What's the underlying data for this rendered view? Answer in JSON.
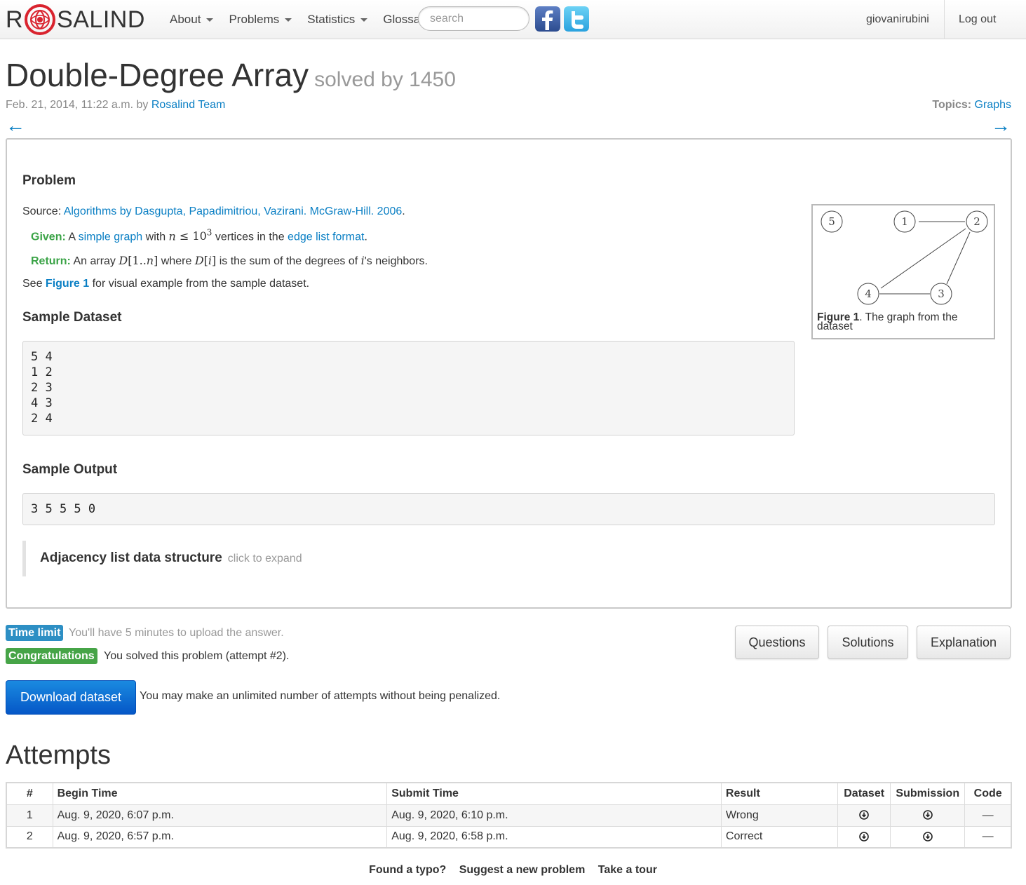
{
  "brand": {
    "letter_r": "R",
    "rest": "SALIND"
  },
  "nav": {
    "items": [
      {
        "label": "About",
        "dropdown": true
      },
      {
        "label": "Problems",
        "dropdown": true
      },
      {
        "label": "Statistics",
        "dropdown": true
      },
      {
        "label": "Glossary",
        "dropdown": false
      }
    ],
    "search_placeholder": "search",
    "social": [
      "facebook-icon",
      "twitter-icon"
    ],
    "user": "giovanirubini",
    "logout": "Log out"
  },
  "problem": {
    "title": "Double-Degree Array",
    "solved_by": "solved by 1450",
    "date": "Feb. 21, 2014, 11:22 a.m. by ",
    "author": "Rosalind Team",
    "topics_label": "Topics:",
    "topic": "Graphs",
    "prev_arrow": "←",
    "next_arrow": "→",
    "heading": "Problem",
    "source_label": "Source: ",
    "source_link": "Algorithms by Dasgupta, Papadimitriou, Vazirani. McGraw-Hill. 2006",
    "source_end": ".",
    "given_label": "Given:",
    "given_a": " A ",
    "given_link1": "simple graph",
    "given_b": " with ",
    "given_c": " vertices in the ",
    "given_link2": "edge list format",
    "given_end": ".",
    "return_label": "Return:",
    "return_a": " An array ",
    "return_b": " where ",
    "return_c": " is the sum of the degrees of ",
    "return_d": "'s neighbors.",
    "see_a": "See ",
    "see_link": "Figure 1",
    "see_b": " for visual example from the sample dataset.",
    "sample_dataset_heading": "Sample Dataset",
    "sample_dataset": "5 4\n1 2\n2 3\n4 3\n2 4",
    "sample_output_heading": "Sample Output",
    "sample_output": "3 5 5 5 0",
    "expand_title": "Adjacency list data structure",
    "expand_hint": "click to expand",
    "figure": {
      "caption_label": "Figure 1",
      "caption_text": ". The graph from the dataset",
      "nodes": [
        "5",
        "1",
        "2",
        "4",
        "3"
      ]
    }
  },
  "status": {
    "time_limit_badge": "Time limit",
    "time_limit_text": "You'll have 5 minutes to upload the answer.",
    "congrats_badge": "Congratulations",
    "congrats_text": "You solved this problem (attempt #2).",
    "download_button": "Download dataset",
    "attempts_note": "You may make an unlimited number of attempts without being penalized.",
    "buttons": {
      "questions": "Questions",
      "solutions": "Solutions",
      "explanation": "Explanation"
    }
  },
  "attempts": {
    "title": "Attempts",
    "headers": [
      "#",
      "Begin Time",
      "Submit Time",
      "Result",
      "Dataset",
      "Submission",
      "Code"
    ],
    "rows": [
      {
        "num": "1",
        "begin": "Aug. 9, 2020, 6:07 p.m.",
        "submit": "Aug. 9, 2020, 6:10 p.m.",
        "result": "Wrong",
        "code": "—"
      },
      {
        "num": "2",
        "begin": "Aug. 9, 2020, 6:57 p.m.",
        "submit": "Aug. 9, 2020, 6:58 p.m.",
        "result": "Correct",
        "code": "—"
      }
    ]
  },
  "footer": {
    "typo": "Found a typo?",
    "suggest": "Suggest a new problem",
    "tour": "Take a tour"
  },
  "colors": {
    "link": "#0a7fc4",
    "green_label": "#3aa346",
    "badge_blue": "#2d8fc4",
    "badge_green": "#46a447",
    "primary": "#0557c7",
    "logo_red": "#d9232e"
  }
}
